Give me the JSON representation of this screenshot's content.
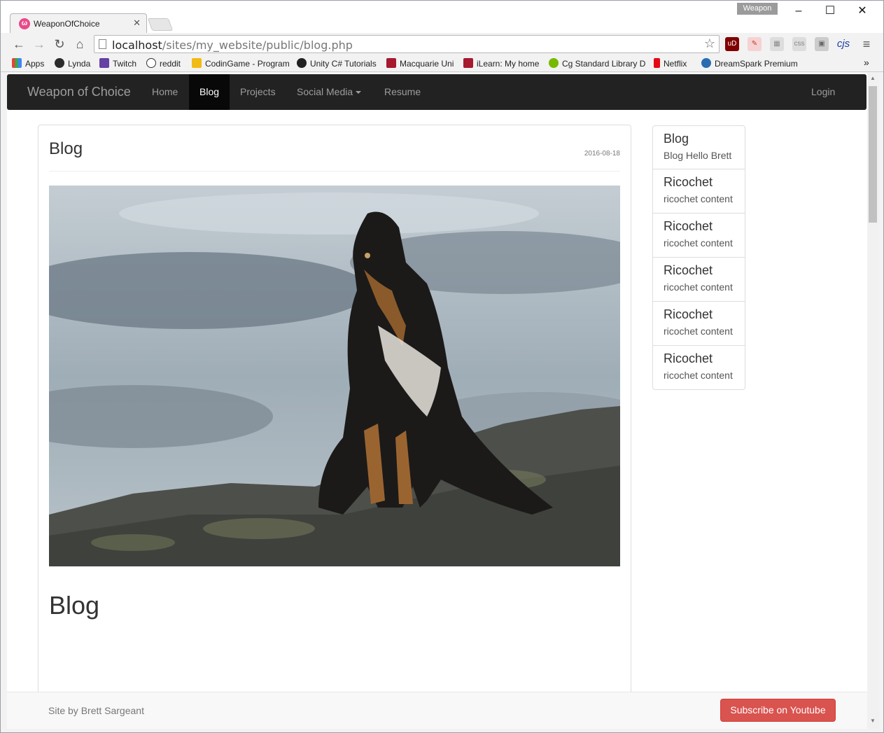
{
  "browser": {
    "tab_title": "WeaponOfChoice",
    "tab_close": "✕",
    "window_label": "Weapon",
    "url_host": "localhost",
    "url_path": "/sites/my_website/public/blog.php",
    "extension_cjs": "cjs",
    "bookmarks": [
      {
        "label": "Apps",
        "color": "#e94235"
      },
      {
        "label": "Lynda",
        "color": "#2b2b2b"
      },
      {
        "label": "Twitch",
        "color": "#6441a4"
      },
      {
        "label": "reddit",
        "color": "#333333"
      },
      {
        "label": "CodinGame - Program",
        "color": "#f2bb13"
      },
      {
        "label": "Unity C# Tutorials",
        "color": "#222222"
      },
      {
        "label": "Macquarie Uni",
        "color": "#a6192e"
      },
      {
        "label": "iLearn: My home",
        "color": "#a6192e"
      },
      {
        "label": "Cg Standard Library D",
        "color": "#76b900"
      },
      {
        "label": "Netflix",
        "color": "#e50914"
      },
      {
        "label": "DreamSpark Premium",
        "color": "#2a6cb0"
      }
    ],
    "bookmarks_overflow": "»"
  },
  "site": {
    "brand": "Weapon of Choice",
    "nav": {
      "home": "Home",
      "blog": "Blog",
      "projects": "Projects",
      "social": "Social Media",
      "resume": "Resume",
      "login": "Login"
    }
  },
  "post": {
    "title": "Blog",
    "date": "2016-08-18",
    "heading": "Blog"
  },
  "sidebar": {
    "items": [
      {
        "title": "Blog",
        "text": "Blog Hello Brett"
      },
      {
        "title": "Ricochet",
        "text": "ricochet content"
      },
      {
        "title": "Ricochet",
        "text": "ricochet content"
      },
      {
        "title": "Ricochet",
        "text": "ricochet content"
      },
      {
        "title": "Ricochet",
        "text": "ricochet content"
      },
      {
        "title": "Ricochet",
        "text": "ricochet content"
      }
    ]
  },
  "footer": {
    "credit": "Site by Brett Sargeant",
    "subscribe": "Subscribe on Youtube"
  }
}
